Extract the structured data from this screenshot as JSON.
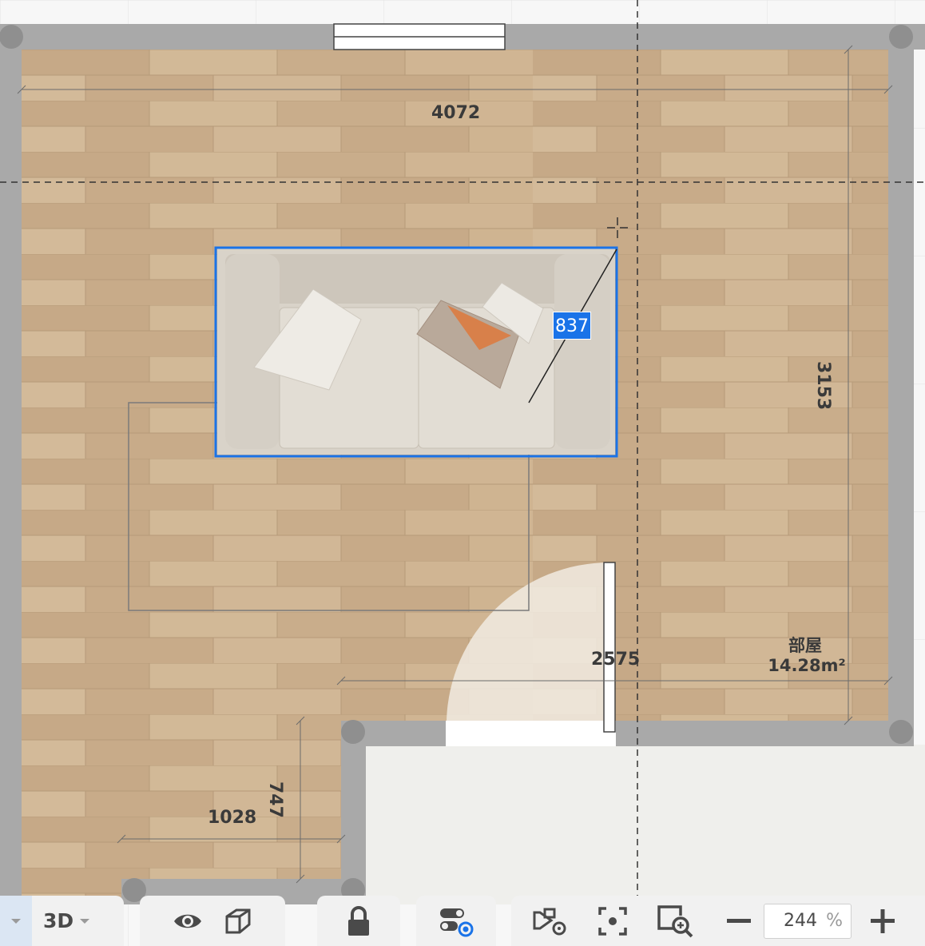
{
  "floorplan": {
    "dimensions": {
      "top_width": "4072",
      "right_height": "3153",
      "door_width": "2575",
      "alcove_width": "1028",
      "alcove_height": "747",
      "sofa_edit": "837"
    },
    "room": {
      "name": "部屋",
      "area": "14.28m²"
    }
  },
  "toolbar": {
    "view_mode_label": "3D",
    "zoom_value": "244",
    "zoom_unit": "%"
  },
  "colors": {
    "wall": "#a9a9a9",
    "floor": "#cbb08f",
    "selection": "#1a73e8",
    "outside_floor": "#efefec"
  },
  "icons": {
    "view_dropdown": "chevron-down-icon",
    "visibility": "eye-icon",
    "object": "cube-icon",
    "lock": "lock-icon",
    "layers_settings": "toggle-target-icon",
    "camera_settings": "camera-gear-icon",
    "focus": "focus-frame-icon",
    "zoom_area": "zoom-in-frame-icon",
    "zoom_out": "minus-icon",
    "zoom_in": "plus-icon"
  }
}
